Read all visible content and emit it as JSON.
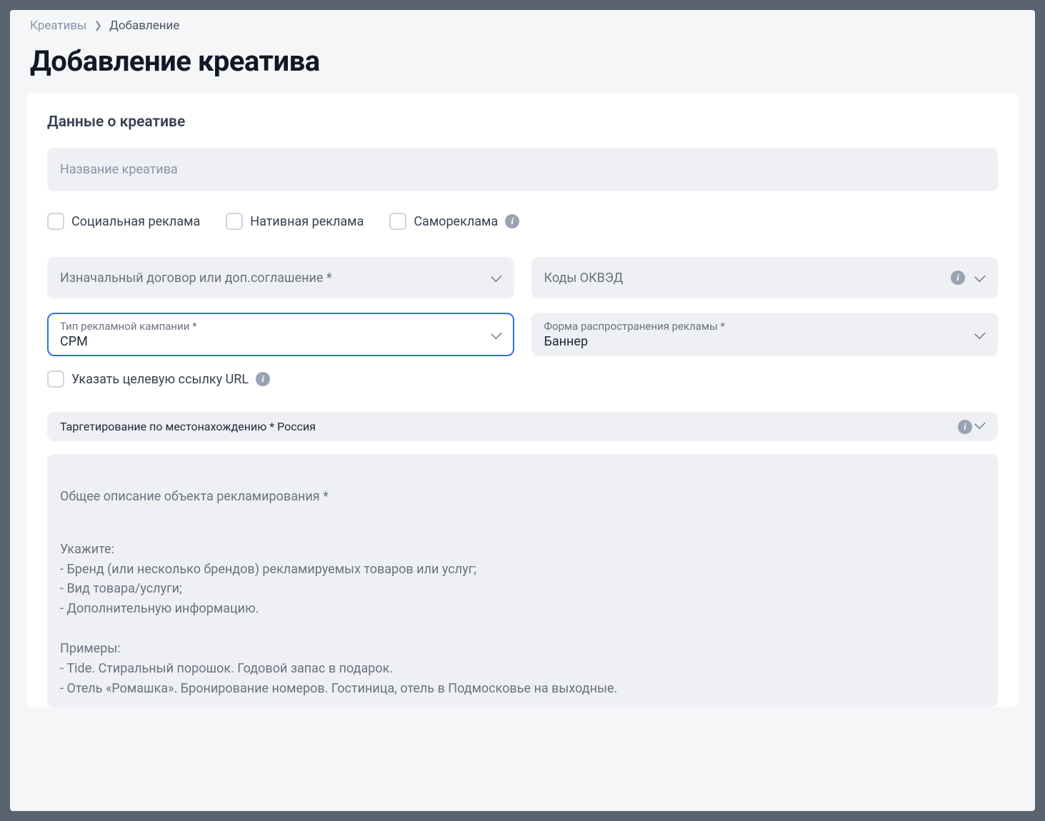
{
  "breadcrumb": {
    "parent": "Креативы",
    "current": "Добавление"
  },
  "page_title": "Добавление креатива",
  "section": {
    "data_title": "Данные о креативе"
  },
  "name_field": {
    "placeholder": "Название креатива"
  },
  "checkboxes": {
    "social": "Социальная реклама",
    "native": "Нативная реклама",
    "self": "Самореклама"
  },
  "selects": {
    "contract": {
      "label": "Изначальный договор или доп.соглашение *"
    },
    "okved": {
      "label": "Коды ОКВЭД"
    },
    "campaign_type": {
      "label": "Тип рекламной кампании *",
      "value": "CPM"
    },
    "distribution": {
      "label": "Форма распространения рекламы *",
      "value": "Баннер"
    },
    "targeting": {
      "label": "Таргетирование по местонахождению *",
      "value": "Россия"
    }
  },
  "url_checkbox": {
    "label": "Указать целевую ссылку URL"
  },
  "description": {
    "label": "Общее описание объекта рекламирования *",
    "placeholder": "Укажите:\n- Бренд (или несколько брендов) рекламируемых товаров или услуг;\n- Вид товара/услуги;\n- Дополнительную информацию.\n\nПримеры:\n- Tide. Стиральный порошок. Годовой запас в подарок.\n- Отель «Ромашка». Бронирование номеров. Гостиница, отель в Подмосковье на выходные."
  }
}
